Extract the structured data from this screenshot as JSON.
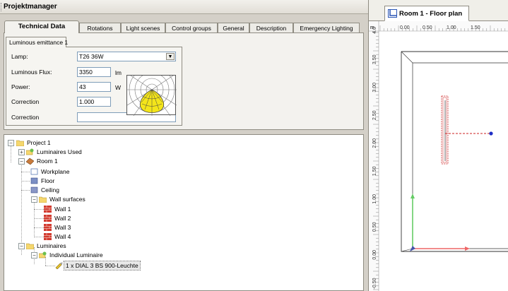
{
  "panel": {
    "title": "Projektmanager"
  },
  "tabs": [
    {
      "label": "Technical Data",
      "active": true
    },
    {
      "label": "Rotations"
    },
    {
      "label": "Light scenes"
    },
    {
      "label": "Control groups"
    },
    {
      "label": "General"
    },
    {
      "label": "Description"
    },
    {
      "label": "Emergency Lighting"
    }
  ],
  "subtab": {
    "label": "Luminous emittance 1"
  },
  "form": {
    "lamp": {
      "label": "Lamp:",
      "value": "T26 36W"
    },
    "flux": {
      "label": "Luminous Flux:",
      "value": "3350",
      "unit": "lm"
    },
    "power": {
      "label": "Power:",
      "value": "43",
      "unit": "W"
    },
    "correction1": {
      "label": "Correction",
      "value": "1.000"
    },
    "correction2": {
      "label": "Correction",
      "value": ""
    }
  },
  "tree": {
    "project": "Project 1",
    "luminaires_used": "Luminaires Used",
    "room": "Room 1",
    "workplane": "Workplane",
    "floor": "Floor",
    "ceiling": "Ceiling",
    "wall_surfaces": "Wall surfaces",
    "walls": [
      "Wall 1",
      "Wall 2",
      "Wall 3",
      "Wall 4"
    ],
    "luminaires": "Luminaires",
    "individual": "Individual Luminaire",
    "luminaire_item": "1 x DIAL 3 BS 900-Leuchte"
  },
  "floorplan": {
    "tab_label": "Room 1 - Floor plan",
    "unit": "m",
    "top_ruler": [
      "0.00",
      "0.50",
      "1.00",
      "1.50"
    ],
    "left_ruler": [
      "4.0",
      "3.50",
      "3.00",
      "2.50",
      "2.00",
      "1.50",
      "1.00",
      "0.50",
      "0.00",
      "-0.50"
    ],
    "colors": {
      "x_axis": "#ee6666",
      "y_axis": "#66cc66",
      "origin": "#4455aa",
      "luminaire": "#cc2222",
      "aim_point": "#1f2ec6"
    }
  }
}
